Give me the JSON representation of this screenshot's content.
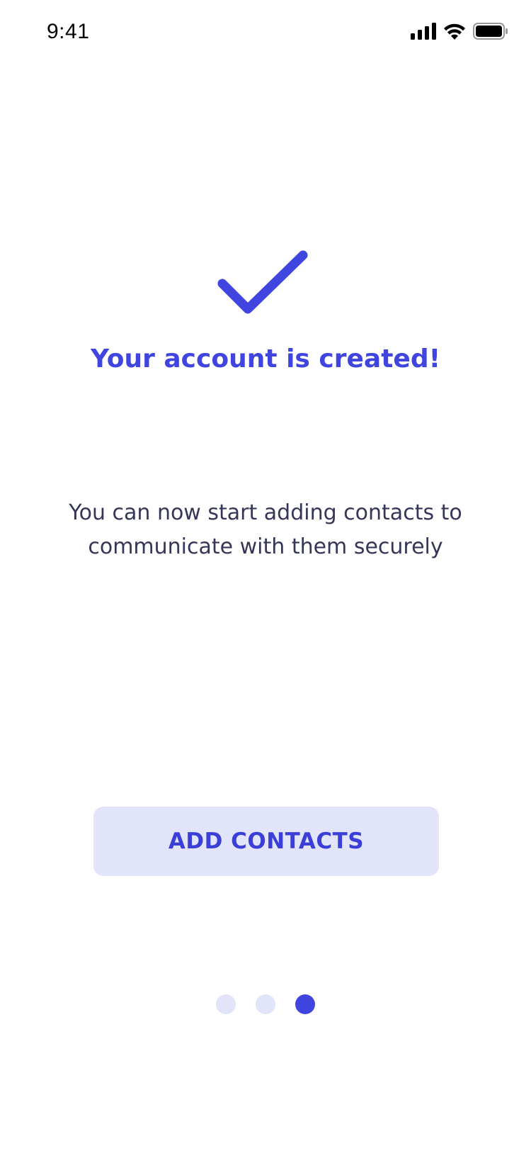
{
  "status_bar": {
    "time": "9:41",
    "icons": [
      "signal-icon",
      "wifi-icon",
      "battery-icon"
    ]
  },
  "success": {
    "icon": "check-icon",
    "title": "Your account is created!",
    "message": "You can now start adding contacts to communicate with them securely"
  },
  "actions": {
    "add_contacts_label": "ADD CONTACTS"
  },
  "pager": {
    "total_pages": 3,
    "current_page": 3
  },
  "colors": {
    "accent": "#4045e0",
    "button_bg": "#e2e5f9",
    "text": "#363658",
    "background": "#ffffff"
  }
}
